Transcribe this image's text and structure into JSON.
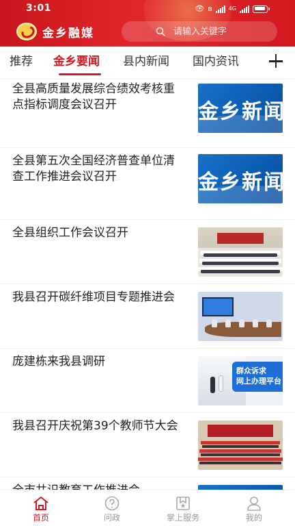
{
  "status_bar": {
    "time": "3:01",
    "network": "4G",
    "battery": "full"
  },
  "header": {
    "app_name": "金乡融媒",
    "search_placeholder": "请输入关键字",
    "icons": [
      "logo-icon",
      "search-icon"
    ]
  },
  "tabs": {
    "items": [
      {
        "label": "推荐",
        "active": false
      },
      {
        "label": "金乡要闻",
        "active": true
      },
      {
        "label": "县内新闻",
        "active": false
      },
      {
        "label": "国内资讯",
        "active": false
      }
    ],
    "add_icon": "plus-icon"
  },
  "news": [
    {
      "title": "全县高质量发展综合绩效考核重点指标调度会议召开",
      "thumb_text": "金乡新闻"
    },
    {
      "title": "全县第五次全国经济普查单位清查工作推进会议召开",
      "thumb_text": "金乡新闻"
    },
    {
      "title": "全县组织工作会议召开"
    },
    {
      "title": "我县召开碳纤维项目专题推进会"
    },
    {
      "title": "庞建栋来我县调研",
      "thumb_text": [
        "群众诉求",
        "网上办理平台"
      ]
    },
    {
      "title": "我县召开庆祝第39个教师节大会"
    },
    {
      "title": "全市共识教育工作推进会"
    }
  ],
  "bottom_nav": [
    {
      "label": "首页",
      "icon": "home-icon",
      "active": true
    },
    {
      "label": "问政",
      "icon": "question-icon",
      "active": false
    },
    {
      "label": "掌上服务",
      "icon": "service-icon",
      "active": false
    },
    {
      "label": "我的",
      "icon": "user-icon",
      "active": false
    }
  ],
  "colors": {
    "brand_red": "#d3191f",
    "header_red": "#e0262c",
    "text": "#222222",
    "muted": "#999999"
  }
}
